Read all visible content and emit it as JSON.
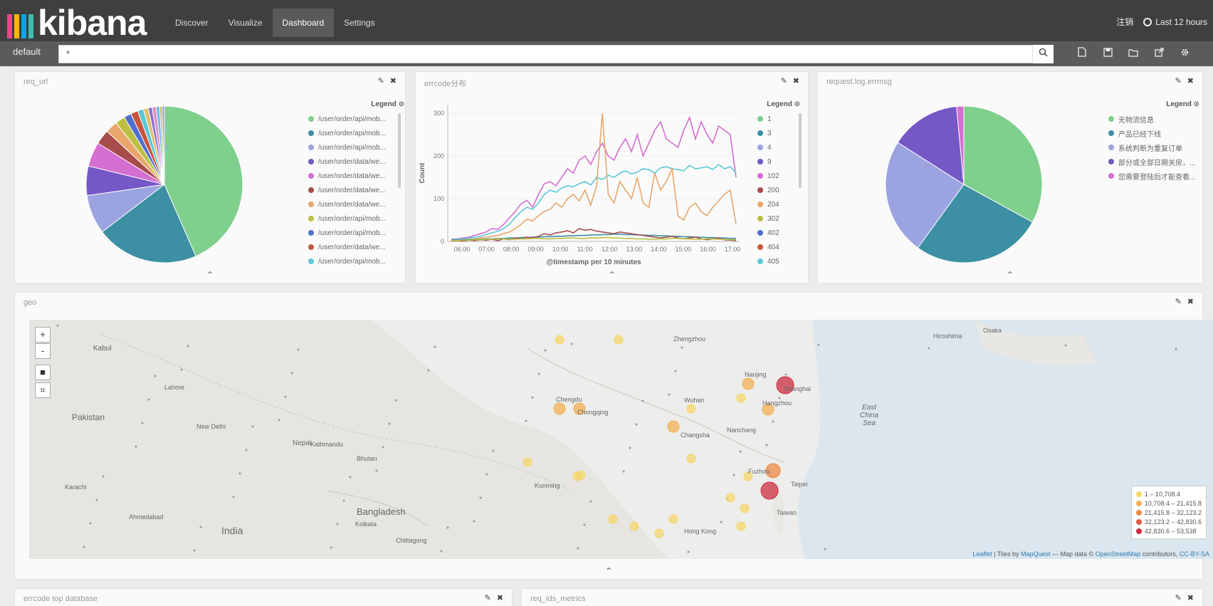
{
  "nav": {
    "logo_text": "kibana",
    "logo_colors": [
      "#e8478b",
      "#f9b700",
      "#00a9e0",
      "#3ebeb0"
    ],
    "tabs": [
      {
        "label": "Discover"
      },
      {
        "label": "Visualize"
      },
      {
        "label": "Dashboard",
        "active": true
      },
      {
        "label": "Settings"
      }
    ],
    "logout": "注销",
    "time_range": "Last 12 hours"
  },
  "search": {
    "index": "default",
    "query": "*",
    "search_icon": "search-icon",
    "tools": [
      "new-dashboard-icon",
      "save-icon",
      "open-icon",
      "share-icon",
      "settings-icon"
    ]
  },
  "panels": {
    "req_url": {
      "title": "req_url",
      "legend_title": "Legend",
      "legend": [
        {
          "label": "/user/order/api/mob...",
          "color": "#7fcf8d"
        },
        {
          "label": "/user/order/api/mob...",
          "color": "#3d8fa3"
        },
        {
          "label": "/user/order/api/mob...",
          "color": "#9ba4e0"
        },
        {
          "label": "/user/order/data/we...",
          "color": "#7657c6"
        },
        {
          "label": "/user/order/data/we...",
          "color": "#d46ed0"
        },
        {
          "label": "/user/order/data/we...",
          "color": "#a84b4b"
        },
        {
          "label": "/user/order/data/we...",
          "color": "#e8a66a"
        },
        {
          "label": "/user/order/api/mob...",
          "color": "#bcbf42"
        },
        {
          "label": "/user/order/api/mob...",
          "color": "#4f6fcf"
        },
        {
          "label": "/user/order/data/we...",
          "color": "#c8553d"
        },
        {
          "label": "/user/order/api/mob...",
          "color": "#5bc8d6"
        }
      ],
      "chart_data": {
        "type": "pie",
        "values": [
          43,
          21,
          8,
          6,
          5,
          3,
          2.5,
          2,
          1.5,
          1.5,
          1.2,
          1,
          0.8,
          0.8,
          0.7,
          0.5,
          0.5
        ],
        "colors": [
          "#7fcf8d",
          "#3d8fa3",
          "#9ba4e0",
          "#7657c6",
          "#d46ed0",
          "#a84b4b",
          "#e8a66a",
          "#bcbf42",
          "#4f6fcf",
          "#c8553d",
          "#5bc8d6",
          "#e0c06b",
          "#8a6fd0",
          "#d88fc0",
          "#6cb7e0",
          "#c0c060",
          "#a090e0"
        ]
      }
    },
    "errcode": {
      "title": "errcode分布",
      "legend_title": "Legend",
      "legend": [
        {
          "label": "1",
          "color": "#7fcf8d"
        },
        {
          "label": "3",
          "color": "#3d8fa3"
        },
        {
          "label": "4",
          "color": "#9ba4e0"
        },
        {
          "label": "9",
          "color": "#7657c6"
        },
        {
          "label": "102",
          "color": "#d46ed0"
        },
        {
          "label": "200",
          "color": "#a84b4b"
        },
        {
          "label": "204",
          "color": "#e8a66a"
        },
        {
          "label": "302",
          "color": "#bcbf42"
        },
        {
          "label": "402",
          "color": "#4f6fcf"
        },
        {
          "label": "404",
          "color": "#c8553d"
        },
        {
          "label": "405",
          "color": "#5bc8d6"
        }
      ],
      "chart_data": {
        "type": "line",
        "x_ticks": [
          "06:00",
          "07:00",
          "08:00",
          "09:00",
          "10:00",
          "11:00",
          "12:00",
          "13:00",
          "14:00",
          "15:00",
          "16:00",
          "17:00"
        ],
        "xlabel": "@timestamp per 10 minutes",
        "ylabel": "Count",
        "y_ticks": [
          "0",
          "100",
          "200",
          "300"
        ],
        "ylim": [
          0,
          320
        ],
        "series": [
          {
            "name": "102",
            "color": "#d46ed0",
            "values": [
              5,
              6,
              8,
              10,
              14,
              18,
              22,
              30,
              28,
              40,
              55,
              70,
              88,
              96,
              80,
              110,
              135,
              140,
              130,
              150,
              170,
              160,
              190,
              200,
              180,
              210,
              230,
              200,
              190,
              220,
              240,
              210,
              250,
              200,
              230,
              260,
              280,
              240,
              230,
              220,
              260,
              290,
              240,
              280,
              250,
              230,
              270,
              260,
              250,
              150
            ]
          },
          {
            "name": "405",
            "color": "#5bc8d6",
            "values": [
              4,
              5,
              6,
              8,
              10,
              12,
              16,
              20,
              24,
              30,
              40,
              56,
              70,
              80,
              75,
              90,
              110,
              120,
              115,
              125,
              130,
              128,
              135,
              140,
              132,
              150,
              145,
              155,
              150,
              160,
              165,
              158,
              162,
              170,
              168,
              160,
              172,
              175,
              170,
              168,
              165,
              178,
              170,
              172,
              175,
              168,
              180,
              170,
              175,
              160
            ]
          },
          {
            "name": "204",
            "color": "#e8a66a",
            "values": [
              2,
              3,
              4,
              5,
              6,
              8,
              10,
              12,
              14,
              18,
              22,
              30,
              40,
              52,
              48,
              60,
              70,
              75,
              90,
              80,
              100,
              110,
              95,
              120,
              85,
              130,
              300,
              110,
              90,
              140,
              120,
              100,
              150,
              90,
              80,
              160,
              120,
              140,
              170,
              60,
              50,
              80,
              90,
              70,
              60,
              80,
              95,
              110,
              120,
              40
            ]
          },
          {
            "name": "3",
            "color": "#3d8fa3",
            "values": [
              3,
              3,
              4,
              4,
              5,
              5,
              6,
              6,
              7,
              7,
              8,
              8,
              9,
              9,
              10,
              10,
              11,
              11,
              12,
              12,
              13,
              13,
              14,
              14,
              15,
              15,
              16,
              16,
              17,
              17,
              16,
              16,
              15,
              15,
              14,
              14,
              13,
              13,
              12,
              12,
              11,
              11,
              10,
              10,
              9,
              9,
              8,
              8,
              7,
              7
            ]
          },
          {
            "name": "200",
            "color": "#a84b4b",
            "values": [
              1,
              2,
              1,
              3,
              2,
              4,
              3,
              5,
              2,
              6,
              4,
              8,
              6,
              10,
              8,
              12,
              18,
              15,
              20,
              22,
              25,
              20,
              30,
              26,
              28,
              24,
              22,
              20,
              18,
              22,
              20,
              18,
              16,
              14,
              12,
              10,
              8,
              10,
              12,
              8,
              6,
              8,
              10,
              6,
              4,
              6,
              8,
              4,
              3,
              2
            ]
          },
          {
            "name": "302",
            "color": "#bcbf42",
            "values": [
              2,
              2,
              3,
              3,
              4,
              4,
              5,
              5,
              6,
              6,
              5,
              5,
              6,
              6,
              7,
              7,
              6,
              6,
              7,
              7,
              8,
              8,
              7,
              7,
              8,
              8,
              9,
              9,
              8,
              8,
              7,
              7,
              6,
              6,
              5,
              5,
              6,
              6,
              7,
              7,
              6,
              6,
              5,
              5,
              6,
              6,
              5,
              5,
              4,
              4
            ]
          }
        ]
      }
    },
    "request_log": {
      "title": "request.log.errmsg",
      "legend_title": "Legend",
      "legend": [
        {
          "label": "无物流信息",
          "color": "#7fcf8d"
        },
        {
          "label": "产品已经下线",
          "color": "#3d8fa3"
        },
        {
          "label": "系统判断为重复订单",
          "color": "#9ba4e0"
        },
        {
          "label": "部分或全部日期关房，...",
          "color": "#7657c6"
        },
        {
          "label": "您需要登陆后才能查看...",
          "color": "#d46ed0"
        }
      ],
      "chart_data": {
        "type": "pie",
        "values": [
          33,
          27,
          24,
          14.5,
          1.5
        ],
        "colors": [
          "#7fcf8d",
          "#3d8fa3",
          "#9ba4e0",
          "#7657c6",
          "#d46ed0"
        ]
      }
    },
    "geo": {
      "title": "geo",
      "legend": [
        {
          "label": "1 – 10,708.4",
          "color": "#f5d66b"
        },
        {
          "label": "10,708.4 – 21,415.8",
          "color": "#f2b055"
        },
        {
          "label": "21,415.8 – 32,123.2",
          "color": "#ec8a43"
        },
        {
          "label": "32,123.2 – 42,830.6",
          "color": "#e15b3e"
        },
        {
          "label": "42,830.6 – 53,538",
          "color": "#cc2d40"
        }
      ],
      "attribution": {
        "leaflet": "Leaflet",
        "tiles": "| Tiles by",
        "mapquest": "MapQuest",
        "mapdata": "— Map data ©",
        "osm": "OpenStreetMap",
        "contrib": "contributors,",
        "license": "CC-BY-SA"
      },
      "places": [
        {
          "name": "Kabul"
        },
        {
          "name": "Pakistan"
        },
        {
          "name": "Lahore"
        },
        {
          "name": "New Delhi"
        },
        {
          "name": "Nepal"
        },
        {
          "name": "Kathmandu"
        },
        {
          "name": "Bhutan"
        },
        {
          "name": "Karachi"
        },
        {
          "name": "Ahmedabad"
        },
        {
          "name": "India"
        },
        {
          "name": "Bangladesh"
        },
        {
          "name": "Kolkata"
        },
        {
          "name": "Chittagong"
        },
        {
          "name": "Chengdu"
        },
        {
          "name": "Chongqing"
        },
        {
          "name": "Kunming"
        },
        {
          "name": "Zhengzhou"
        },
        {
          "name": "Wuhan"
        },
        {
          "name": "Changsha"
        },
        {
          "name": "Nanchang"
        },
        {
          "name": "Nanjing"
        },
        {
          "name": "Shanghai"
        },
        {
          "name": "Hangzhou"
        },
        {
          "name": "Fuzhou"
        },
        {
          "name": "Taipei"
        },
        {
          "name": "Taiwan"
        },
        {
          "name": "Hong Kong"
        },
        {
          "name": "East China Sea"
        },
        {
          "name": "Hiroshima"
        },
        {
          "name": "Osaka"
        }
      ],
      "bubbles": [
        {
          "bucket": 0
        },
        {
          "bucket": 0
        },
        {
          "bucket": 1
        },
        {
          "bucket": 1
        },
        {
          "bucket": 0
        },
        {
          "bucket": 0
        },
        {
          "bucket": 1
        },
        {
          "bucket": 0
        },
        {
          "bucket": 1
        },
        {
          "bucket": 4
        },
        {
          "bucket": 1
        },
        {
          "bucket": 0
        },
        {
          "bucket": 0
        },
        {
          "bucket": 0
        },
        {
          "bucket": 0
        },
        {
          "bucket": 4
        },
        {
          "bucket": 2
        },
        {
          "bucket": 0
        },
        {
          "bucket": 0
        },
        {
          "bucket": 0
        },
        {
          "bucket": 0
        },
        {
          "bucket": 0
        },
        {
          "bucket": 0
        },
        {
          "bucket": 0
        }
      ]
    },
    "errcode_top": {
      "title": "errcode top database"
    },
    "req_ids": {
      "title": "req_ids_metrics"
    }
  }
}
